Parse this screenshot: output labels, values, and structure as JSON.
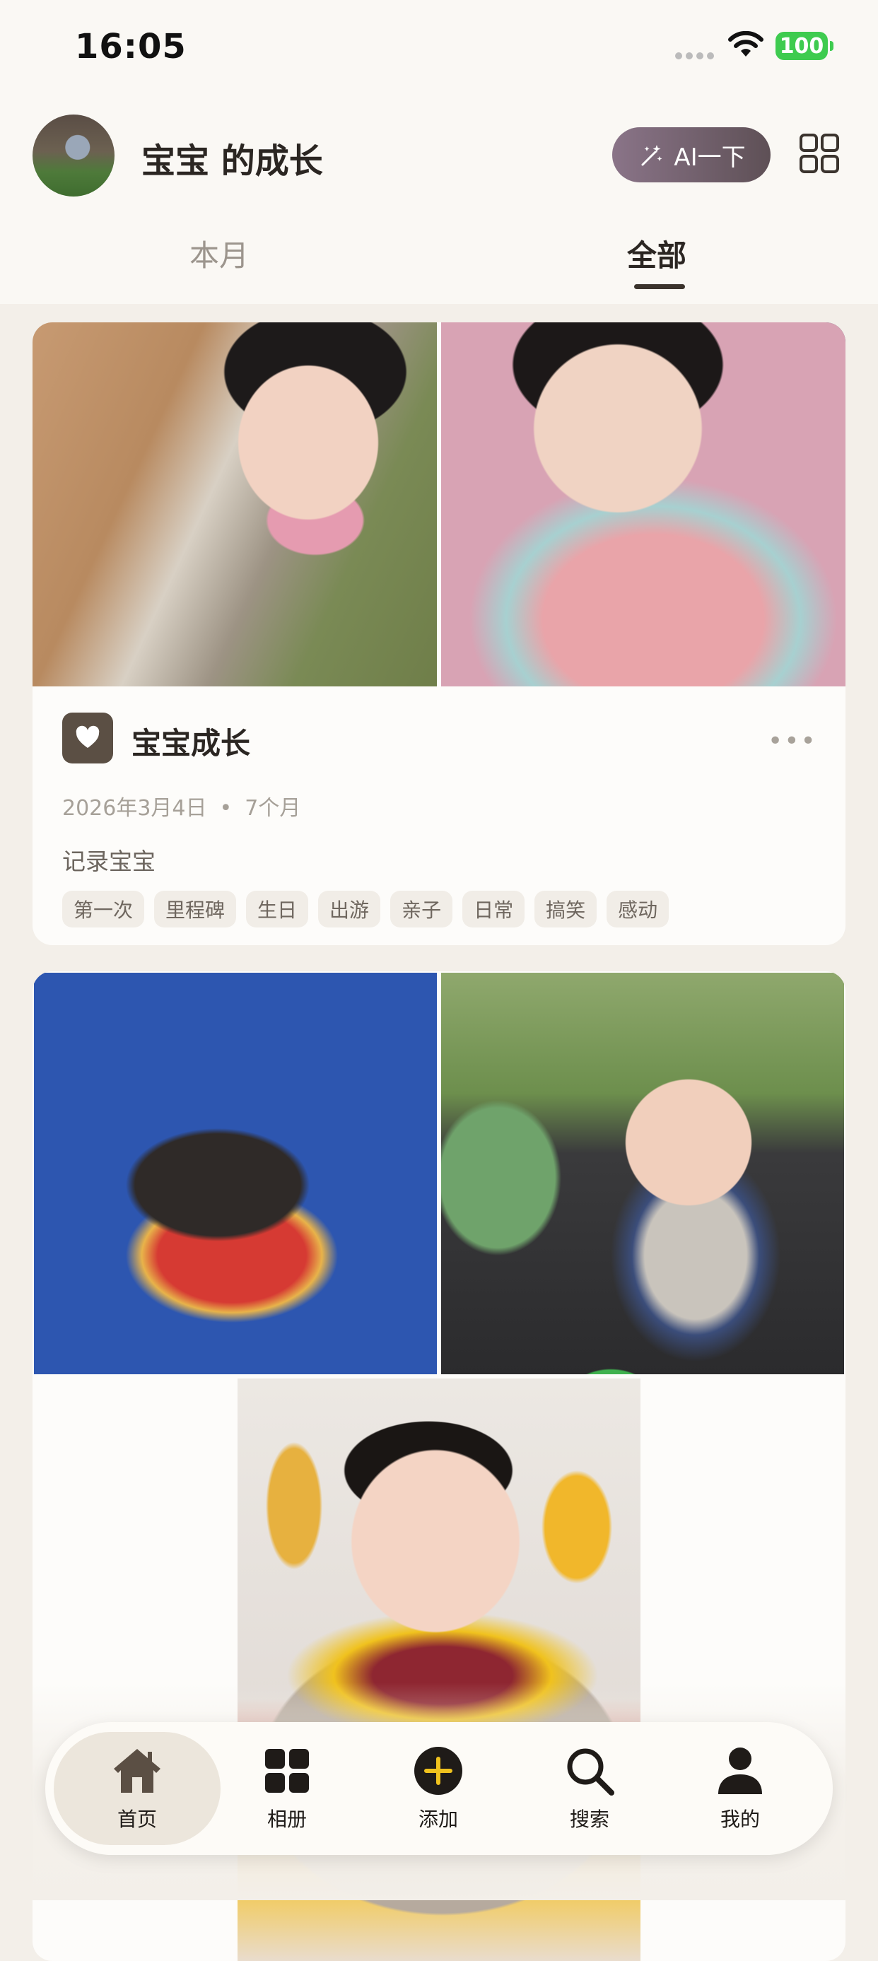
{
  "status_bar": {
    "time": "16:05",
    "battery": "100"
  },
  "header": {
    "title": "宝宝 的成长",
    "ai_button_label": "AI一下",
    "tabs": [
      {
        "label": "本月",
        "active": false
      },
      {
        "label": "全部",
        "active": true
      }
    ]
  },
  "card1": {
    "title": "宝宝成长",
    "date": "2026年3月4日",
    "age": "7个月",
    "description": "记录宝宝",
    "tags": [
      "第一次",
      "里程碑",
      "生日",
      "出游",
      "亲子",
      "日常",
      "搞笑",
      "感动"
    ]
  },
  "tabbar": {
    "items": [
      {
        "label": "首页",
        "icon": "home-icon",
        "active": true
      },
      {
        "label": "相册",
        "icon": "grid-icon",
        "active": false
      },
      {
        "label": "添加",
        "icon": "add-icon",
        "active": false
      },
      {
        "label": "搜索",
        "icon": "search-icon",
        "active": false
      },
      {
        "label": "我的",
        "icon": "person-icon",
        "active": false
      }
    ]
  },
  "colors": {
    "background": "#f3efe9",
    "accent": "#5b4f44",
    "ai_button": "#7a6778",
    "battery": "#3ecb4f"
  }
}
